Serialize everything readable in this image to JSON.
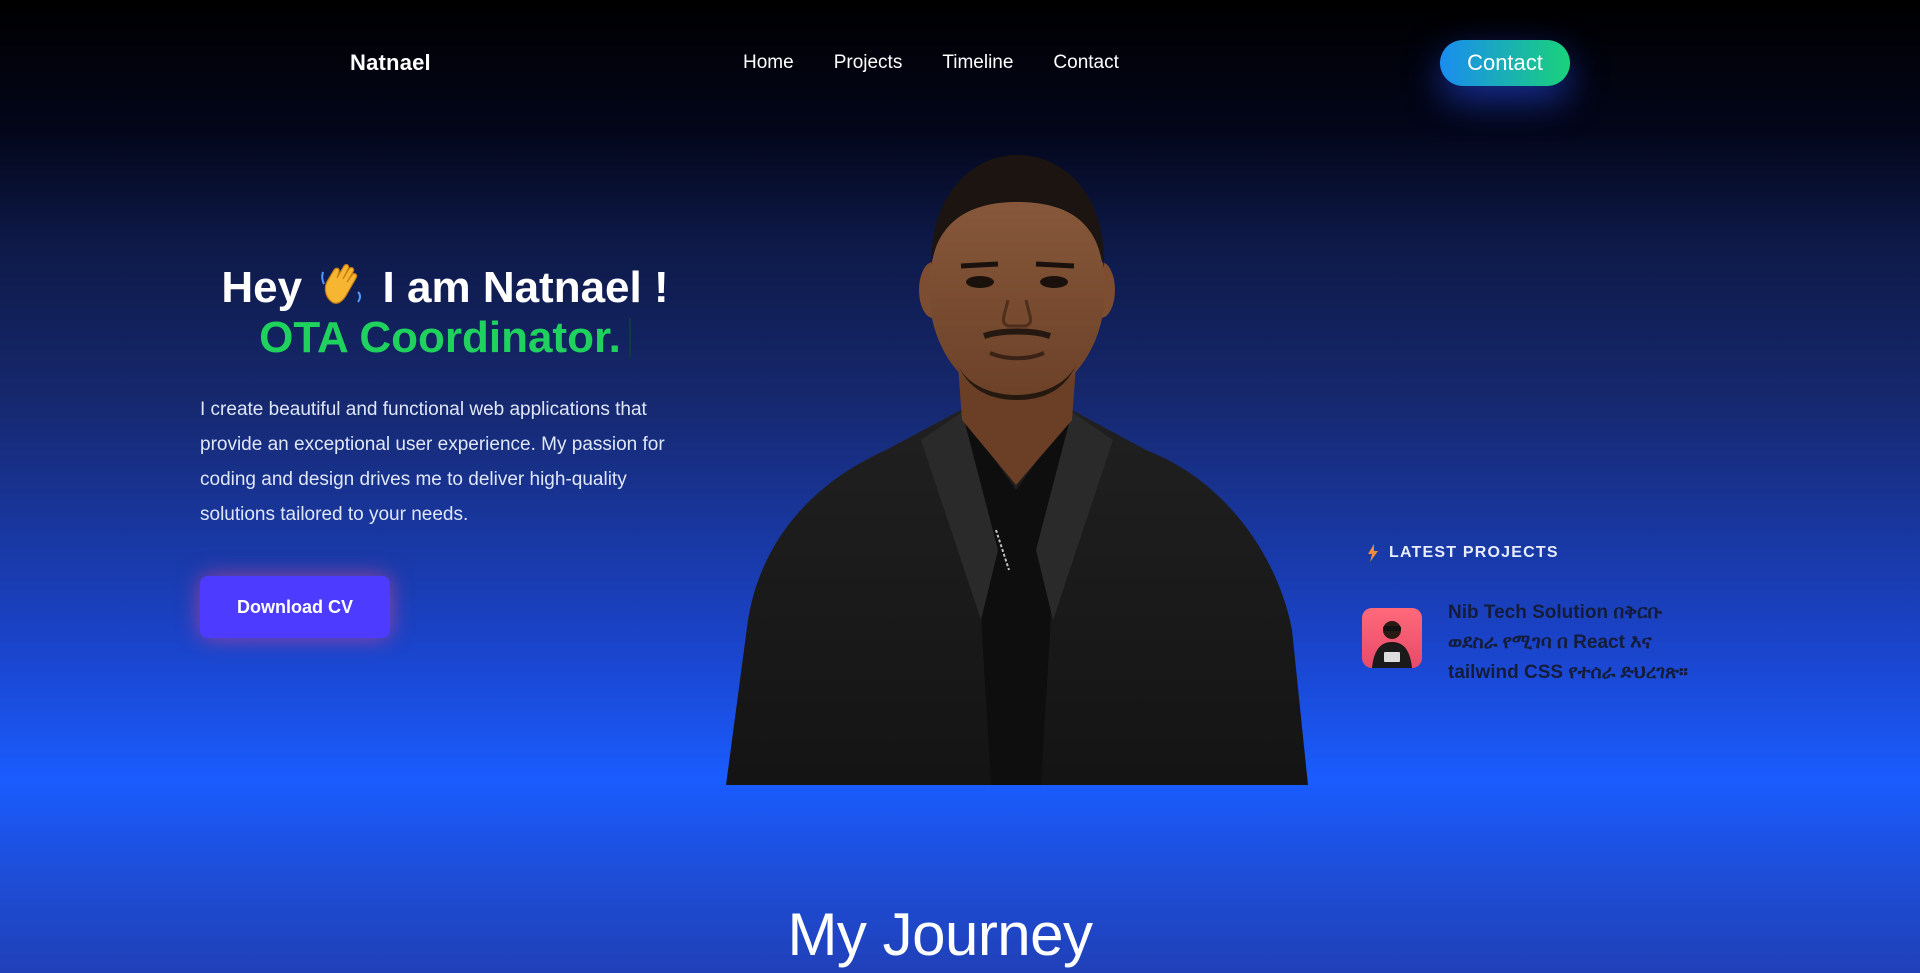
{
  "nav": {
    "brand": "Natnael",
    "links": [
      "Home",
      "Projects",
      "Timeline",
      "Contact"
    ],
    "cta_label": "Contact"
  },
  "hero": {
    "greeting_prefix": "Hey",
    "wave_icon": "waving-hand-icon",
    "greeting_suffix": "I am Natnael !",
    "role": "OTA Coordinator.",
    "description": "I create beautiful and functional web applications that provide an exceptional user experience. My passion for coding and design drives me to deliver high-quality solutions tailored to your needs.",
    "download_label": "Download CV"
  },
  "latest_projects": {
    "heading": "LATEST PROJECTS",
    "icon": "bolt-icon",
    "items": [
      {
        "title": "Nib Tech Solution በቅርቡ ወደስራ የሚገባ በ React እና tailwind CSS የተሰራ ድህረገጽ።",
        "thumb_icon": "project-thumbnail"
      }
    ]
  },
  "journey": {
    "heading": "My Journey"
  },
  "colors": {
    "accent_green": "#1fd15d",
    "button_purple": "#4d3bff",
    "cta_gradient_start": "#1a8cf0",
    "cta_gradient_end": "#1ad27a"
  }
}
